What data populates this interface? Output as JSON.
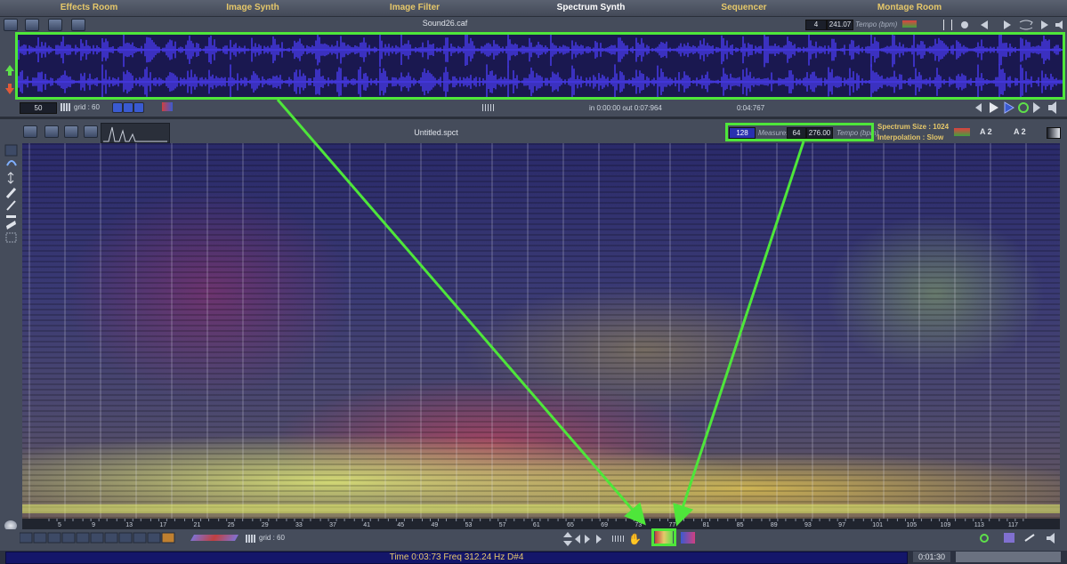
{
  "tabs": [
    "Effects Room",
    "Image Synth",
    "Image Filter",
    "Spectrum Synth",
    "Sequencer",
    "Montage Room"
  ],
  "active_tab": "Spectrum Synth",
  "top_panel": {
    "file_name": "Sound26.caf",
    "measure_value": "4",
    "tempo_value": "241.07",
    "tempo_label": "Tempo (bpm)",
    "zoom_value": "50",
    "grid_label": "grid : 60",
    "in_out": "in 0:00:00  out 0:07:964",
    "position": "0:04:767"
  },
  "spectrum_panel": {
    "file_name": "Untitled.spct",
    "measures_value": "128",
    "measures_label": "Measures",
    "beats_value": "64",
    "tempo_value": "276.00",
    "tempo_label": "Tempo (bpm)",
    "spectrum_size": "Spectrum Size : 1024",
    "interpolation": "Interpolation : Slow",
    "note_a": "A 2",
    "note_b": "A 2"
  },
  "bottom": {
    "grid_label": "grid : 60",
    "status_text": "Time 0:03:73 Freq 312.24 Hz D#4",
    "time_right": "0:01:30"
  },
  "ruler_labels": [
    "5",
    "9",
    "13",
    "17",
    "21",
    "25",
    "29",
    "33",
    "37",
    "41",
    "45",
    "49",
    "53",
    "57",
    "61",
    "65",
    "69",
    "73",
    "77",
    "81",
    "85",
    "89",
    "93",
    "97",
    "101",
    "105",
    "109",
    "113",
    "117"
  ],
  "colors": {
    "accent": "#4ee63a",
    "tab_text": "#e6c86a",
    "wave": "#4a3cf0"
  },
  "icons": [
    "add-track-icon",
    "remove-track-icon",
    "play-icon",
    "stop-icon",
    "record-icon",
    "speaker-icon",
    "hand-icon",
    "arrow-icon"
  ]
}
